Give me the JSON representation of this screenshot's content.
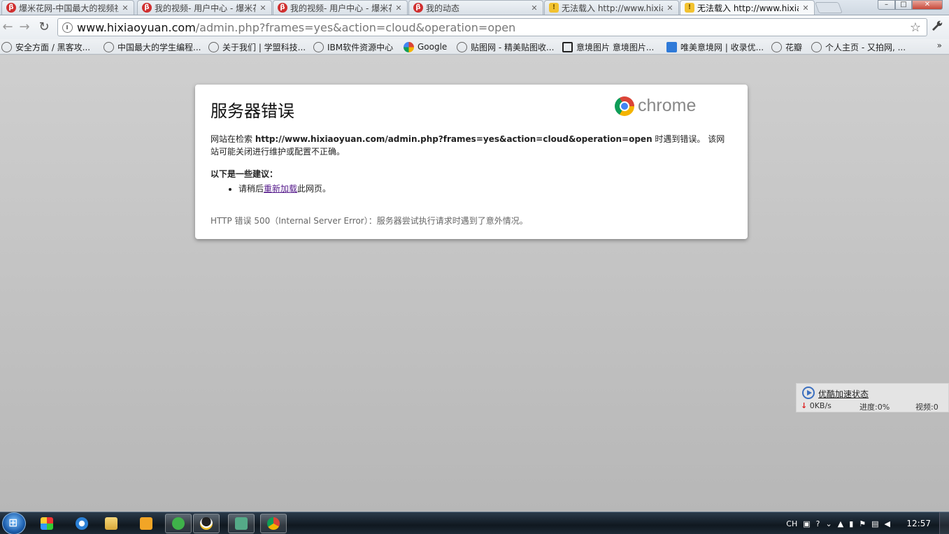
{
  "tabs": [
    {
      "title": "爆米花网-中国最大的视频社",
      "icon": "popcorn-icon"
    },
    {
      "title": "我的视频- 用户中心 - 爆米花",
      "icon": "popcorn-icon"
    },
    {
      "title": "我的视频- 用户中心 - 爆米花",
      "icon": "popcorn-icon"
    },
    {
      "title": "我的动态",
      "icon": "popcorn-icon"
    },
    {
      "title": "无法载入 http://www.hixia",
      "icon": "warning-icon"
    },
    {
      "title": "无法载入 http://www.hixia",
      "icon": "warning-icon"
    }
  ],
  "window_controls": {
    "minimize": "–",
    "maximize": "□",
    "close": "✕"
  },
  "toolbar": {
    "back": "←",
    "forward": "→",
    "reload": "↻",
    "url_host": "www.hixiaoyuan.com",
    "url_path": "/admin.php?frames=yes&action=cloud&operation=open",
    "star": "☆",
    "wrench": "🔧"
  },
  "bookmarks": [
    {
      "label": "安全方面 / 黑客攻...",
      "icon": "globe-icon"
    },
    {
      "label": "中国最大的学生编程...",
      "icon": "globe-icon"
    },
    {
      "label": "关于我们 | 学盟科技...",
      "icon": "globe-icon"
    },
    {
      "label": "IBM软件资源中心",
      "icon": "globe-icon"
    },
    {
      "label": "Google",
      "icon": "google-icon"
    },
    {
      "label": "贴图网 - 精美贴图收...",
      "icon": "globe-icon"
    },
    {
      "label": "意境图片 意境图片...",
      "icon": "square-icon"
    },
    {
      "label": "唯美意境网 | 收录优...",
      "icon": "blue-icon"
    },
    {
      "label": "花瓣",
      "icon": "globe-icon"
    },
    {
      "label": "个人主页 - 又拍网, ...",
      "icon": "globe-icon"
    }
  ],
  "bookmarks_more": "»",
  "error_page": {
    "title": "服务器错误",
    "logo_text": "chrome",
    "message_prefix": "网站在检索 ",
    "message_url": "http://www.hixiaoyuan.com/admin.php?frames=yes&action=cloud&operation=open",
    "message_suffix": " 时遇到错误。 该网站可能关闭进行维护或配置不正确。",
    "suggestions_heading": "以下是一些建议：",
    "suggestion_prefix": "请稍后",
    "suggestion_link": "重新加载",
    "suggestion_suffix": "此网页。",
    "error_code": "HTTP 错误 500（Internal Server Error）：服务器尝试执行请求时遇到了意外情况。"
  },
  "youku_widget": {
    "title": "优酷加速状态",
    "speed": "0KB/s",
    "progress": "进度:0%",
    "videos": "视频:0"
  },
  "taskbar": {
    "apps": [
      "media-center-icon",
      "ie-icon",
      "explorer-icon",
      "media-player-icon",
      "green-browser-icon",
      "qq-icon",
      "network-icon",
      "chrome-icon"
    ],
    "tray_lang": "CH",
    "clock": "12:57"
  }
}
